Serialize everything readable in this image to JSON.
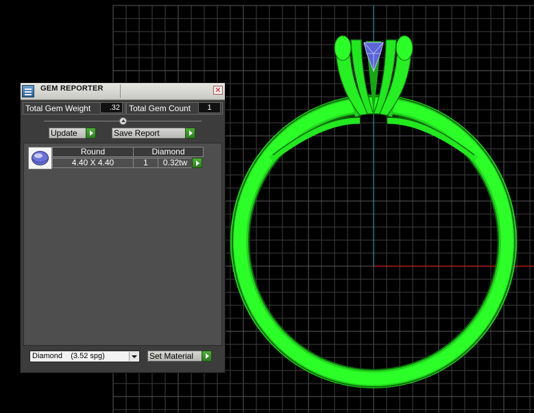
{
  "panel": {
    "title": "GEM REPORTER",
    "close_symbol": "✕",
    "total_gem_weight_label": "Total Gem Weight",
    "total_gem_weight_value": ".32",
    "total_gem_count_label": "Total Gem Count",
    "total_gem_count_value": "1",
    "update_label": "Update",
    "save_report_label": "Save Report",
    "table": {
      "headers": [
        "Round",
        "Diamond"
      ],
      "rows": [
        {
          "size": "4.40 X 4.40",
          "count": "1",
          "weight": "0.32tw"
        }
      ]
    },
    "material_select_value": "Diamond    (3.52 spg)",
    "set_material_label": "Set Material"
  },
  "colors": {
    "ring_green": "#22e81f",
    "grid": "#3f3f3f",
    "axis_vertical": "#29b8c8",
    "axis_horizontal": "#d42020",
    "play_button": "#3a9a2a",
    "gem": "#6a72d8"
  },
  "icons": [
    "gem-reporter-app-icon",
    "close-icon",
    "collapse-arrow-icon",
    "play-arrow-icon",
    "round-gem-icon",
    "dropdown-arrow-icon"
  ]
}
